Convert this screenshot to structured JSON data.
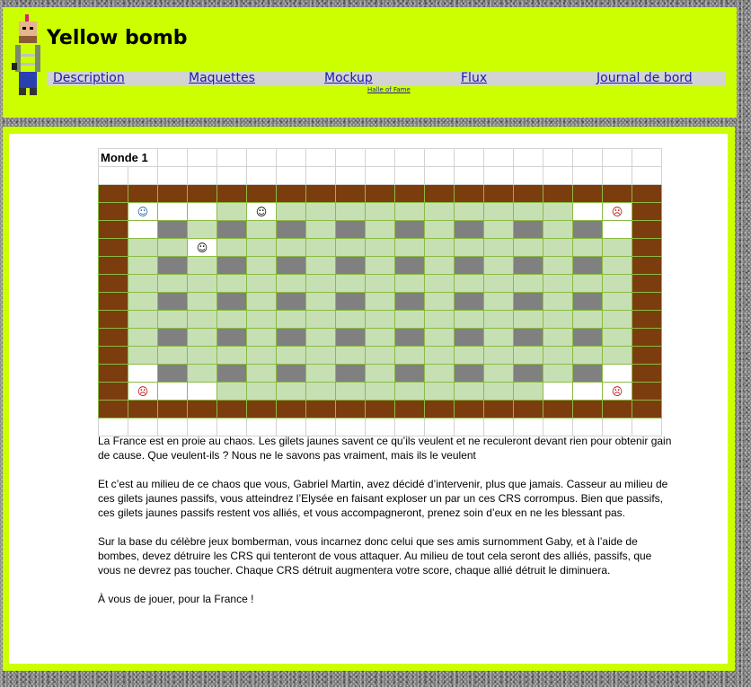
{
  "header": {
    "site_title": "Yellow bomb",
    "avatar_icon": "gilet-jaune-character-icon",
    "nav": [
      {
        "label": "Description"
      },
      {
        "label": "Maquettes"
      },
      {
        "label": "Mockup"
      },
      {
        "label": "Flux"
      },
      {
        "label": "Journal de bord"
      }
    ],
    "hall_of_fame": "Halle of Fame"
  },
  "colors": {
    "frame": "#ccff00",
    "wall": "#7b3d0d",
    "floor": "#c6e0b4",
    "block": "#808080",
    "nav_bg": "#d3d3d3"
  },
  "world": {
    "title": "Monde 1",
    "columns": 19,
    "map": [
      "WWWWWWWWWWWWWWWWWWW",
      "WEEEFEFFFFFFFFFFEEW",
      "WEBFBFBFBFBFBFBFBEW",
      "WFFEFFFFFFFFFFFFFFW",
      "WFBFBFBFBFBFBFBFBFW",
      "WFFFFFFFFFFFFFFFFFW",
      "WFBFBFBFBFBFBFBFBFW",
      "WFFFFFFFFFFFFFFFFFW",
      "WFBFBFBFBFBFBFBFBFW",
      "WFFFFFFFFFFFFFFFFFW",
      "WEBFBFBFBFBFBFBFBEW",
      "WEEEFFFFFFFFFFFEEEW",
      "WWWWWWWWWWWWWWWWWWW"
    ],
    "characters": [
      {
        "row": 1,
        "col": 1,
        "symbol": "☺",
        "kind": "player"
      },
      {
        "row": 1,
        "col": 5,
        "symbol": "☺",
        "kind": "ally"
      },
      {
        "row": 1,
        "col": 17,
        "symbol": "☹",
        "kind": "crs"
      },
      {
        "row": 3,
        "col": 3,
        "symbol": "☺",
        "kind": "ally"
      },
      {
        "row": 11,
        "col": 1,
        "symbol": "☹",
        "kind": "crs"
      },
      {
        "row": 11,
        "col": 17,
        "symbol": "☹",
        "kind": "crs"
      }
    ]
  },
  "story": [
    "La France est en proie au chaos. Les gilets jaunes savent ce qu’ils veulent et ne reculeront devant rien pour obtenir gain de cause. Que veulent-ils ? Nous ne le savons pas vraiment, mais ils le veulent",
    "Et c’est au milieu de ce chaos que vous, Gabriel Martin, avez décidé d’intervenir, plus que jamais. Casseur au milieu de ces gilets jaunes passifs, vous atteindrez l’Elysée en faisant exploser un par un ces CRS corrompus. Bien que passifs, ces gilets jaunes passifs restent vos alliés, et vous accompagneront, prenez soin d’eux en ne les blessant pas.",
    "Sur la base du célèbre jeux bomberman, vous incarnez donc celui que ses amis surnomment Gaby, et à l’aide de bombes, devez détruire les CRS qui tenteront de vous attaquer. Au milieu de tout cela seront des alliés, passifs, que vous ne devrez pas toucher. Chaque CRS détruit augmentera votre score, chaque allié détruit le diminuera.",
    "À vous de jouer, pour la France !"
  ]
}
